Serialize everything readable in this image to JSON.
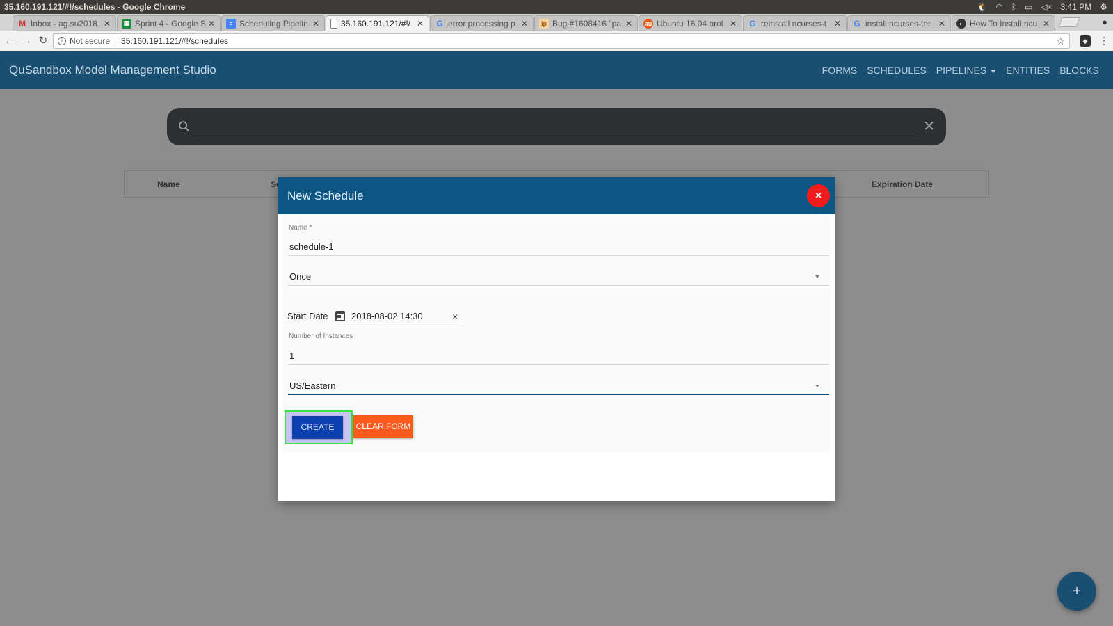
{
  "os": {
    "window_title": "35.160.191.121/#!/schedules - Google Chrome",
    "time": "3:41 PM"
  },
  "browser": {
    "tabs": [
      {
        "title": "Inbox - ag.su2018",
        "favicon": "gmail-icon",
        "active": false
      },
      {
        "title": "Sprint 4 - Google S",
        "favicon": "sheets-icon",
        "active": false
      },
      {
        "title": "Scheduling Pipelin",
        "favicon": "docs-icon",
        "active": false
      },
      {
        "title": "35.160.191.121/#!/",
        "favicon": "page-icon",
        "active": true
      },
      {
        "title": "error processing p",
        "favicon": "google-icon",
        "active": false
      },
      {
        "title": "Bug #1608416 \"pa",
        "favicon": "launchpad-icon",
        "active": false
      },
      {
        "title": "Ubuntu 16.04 brol",
        "favicon": "askubuntu-icon",
        "active": false
      },
      {
        "title": "reinstall ncurses-t",
        "favicon": "google-icon",
        "active": false
      },
      {
        "title": "install ncurses-ter",
        "favicon": "google-icon",
        "active": false
      },
      {
        "title": "How To Install ncu",
        "favicon": "site-icon",
        "active": false
      }
    ],
    "not_secure": "Not secure",
    "url": "35.160.191.121/#!/schedules"
  },
  "app": {
    "title": "QuSandbox Model Management Studio",
    "nav": [
      "FORMS",
      "SCHEDULES",
      "PIPELINES",
      "ENTITIES",
      "BLOCKS"
    ],
    "search": {
      "value": ""
    },
    "table_headers": {
      "name": "Name",
      "schedule": "Sc",
      "expiration": "Expiration Date"
    },
    "fab": "+"
  },
  "modal": {
    "title": "New Schedule",
    "close": "×",
    "name_label": "Name *",
    "name_value": "schedule-1",
    "frequency_value": "Once",
    "start_date_label": "Start Date",
    "start_date_value": "2018-08-02 14:30",
    "date_clear": "×",
    "instances_label": "Number of Instances",
    "instances_value": "1",
    "timezone_value": "US/Eastern",
    "create_label": "CREATE",
    "clear_label": "CLEAR FORM"
  },
  "colors": {
    "app_bar": "#1b4f72",
    "modal_header": "#0d5683",
    "create_button": "#0c3fb0",
    "clear_button": "#fb5a1f",
    "close_button": "#f21b1b",
    "highlight_outline": "#38e83b"
  }
}
